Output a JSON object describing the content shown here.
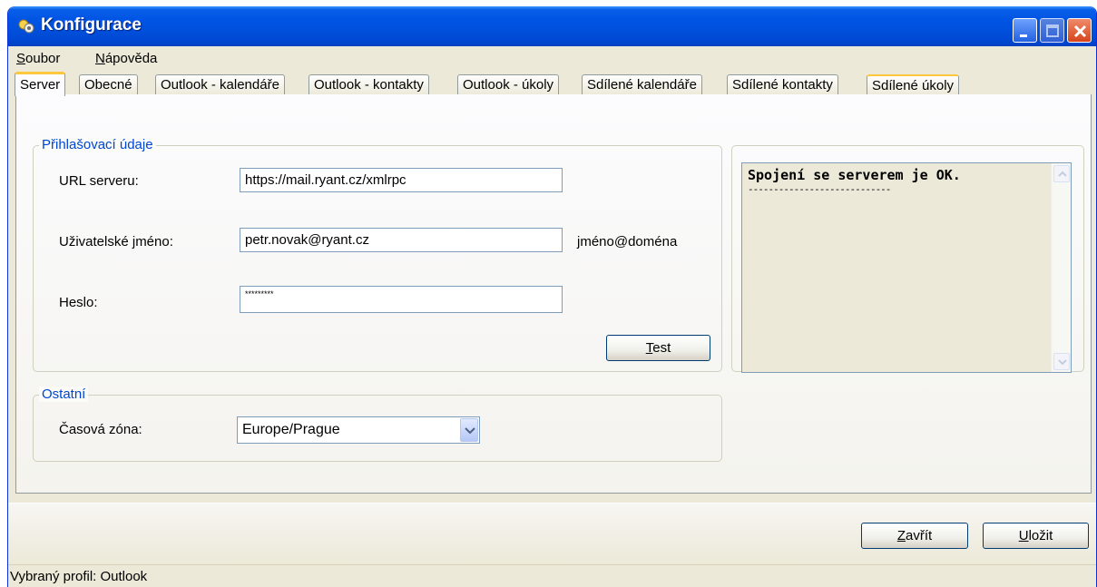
{
  "window": {
    "title": "Konfigurace"
  },
  "menu": {
    "items": [
      {
        "label": "Soubor",
        "accel": "S",
        "rest": "oubor"
      },
      {
        "label": "Nápověda",
        "accel": "N",
        "rest": "ápověda"
      }
    ]
  },
  "tabs": [
    {
      "label": "Server",
      "active": true
    },
    {
      "label": "Obecné"
    },
    {
      "label": "Outlook - kalendáře"
    },
    {
      "label": "Outlook - kontakty"
    },
    {
      "label": "Outlook - úkoly"
    },
    {
      "label": "Sdílené kalendáře"
    },
    {
      "label": "Sdílené kontakty"
    },
    {
      "label": "Sdílené úkoly",
      "hot": true
    }
  ],
  "login_group": {
    "legend": "Přihlašovací údaje",
    "url_label": "URL serveru:",
    "url_value": "https://mail.ryant.cz/xmlrpc",
    "user_label": "Uživatelské jméno:",
    "user_value": "petr.novak@ryant.cz",
    "user_hint": "jméno@doména",
    "password_label": "Heslo:",
    "password_value": "*********",
    "test_button": {
      "accel": "T",
      "rest": "est"
    }
  },
  "other_group": {
    "legend": "Ostatní",
    "timezone_label": "Časová zóna:",
    "timezone_value": "Europe/Prague"
  },
  "log": {
    "message": "Spojení se serverem je OK.",
    "separator": "----------------------------"
  },
  "buttons": {
    "close": {
      "accel": "Z",
      "rest": "avřít"
    },
    "save": {
      "accel": "U",
      "rest": "ložit"
    }
  },
  "status": {
    "text": "Vybraný profil: Outlook"
  },
  "colors": {
    "titlebar": "#0055e5",
    "legend": "#0046d5",
    "tab_highlight": "#ffc83c",
    "face": "#ece9d8"
  }
}
